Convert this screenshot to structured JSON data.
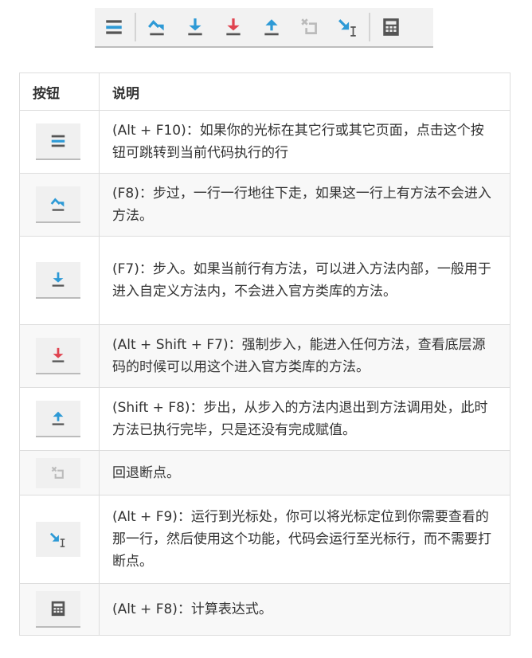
{
  "toolbar": {
    "icons": [
      "show-execution-point-icon",
      "step-over-icon",
      "step-into-icon",
      "force-step-into-icon",
      "step-out-icon",
      "drop-frame-icon",
      "run-to-cursor-icon",
      "evaluate-expression-icon"
    ]
  },
  "colors": {
    "blue": "#2e9ad6",
    "red": "#e0434f",
    "gray": "#555555"
  },
  "table": {
    "headers": [
      "按钮",
      "说明"
    ],
    "rows": [
      {
        "icon": "show-execution-point-icon",
        "text": "(Alt + F10)：如果你的光标在其它行或其它页面，点击这个按钮可跳转到当前代码执行的行"
      },
      {
        "icon": "step-over-icon",
        "text": "(F8)：步过，一行一行地往下走，如果这一行上有方法不会进入方法。"
      },
      {
        "icon": "step-into-icon",
        "text": "(F7)：步入。如果当前行有方法，可以进入方法内部，一般用于进入自定义方法内，不会进入官方类库的方法。"
      },
      {
        "icon": "force-step-into-icon",
        "text": "(Alt + Shift + F7)：强制步入，能进入任何方法，查看底层源码的时候可以用这个进入官方类库的方法。"
      },
      {
        "icon": "step-out-icon",
        "text": "(Shift + F8)：步出，从步入的方法内退出到方法调用处，此时方法已执行完毕，只是还没有完成赋值。"
      },
      {
        "icon": "drop-frame-icon",
        "text": "回退断点。"
      },
      {
        "icon": "run-to-cursor-icon",
        "text": "(Alt + F9)：运行到光标处，你可以将光标定位到你需要查看的那一行，然后使用这个功能，代码会运行至光标行，而不需要打断点。"
      },
      {
        "icon": "evaluate-expression-icon",
        "text": "(Alt + F8)：计算表达式。"
      }
    ]
  }
}
